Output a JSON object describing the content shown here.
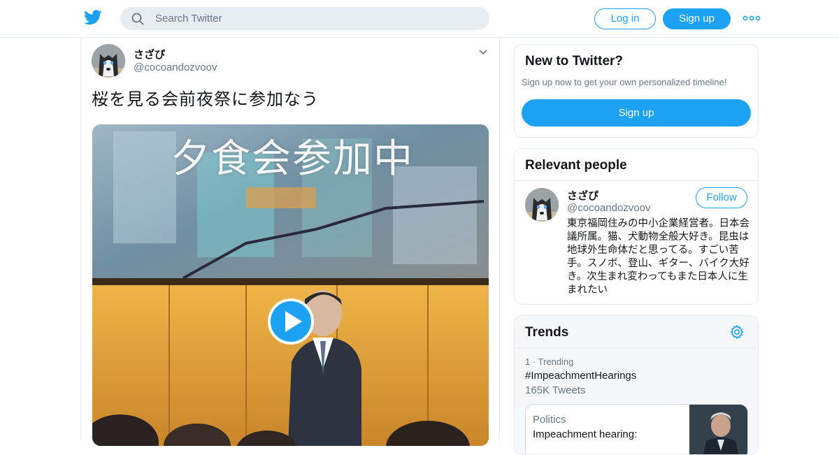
{
  "header": {
    "logo_icon": "twitter-bird-icon",
    "search_placeholder": "Search Twitter",
    "login_label": "Log in",
    "signup_label": "Sign up",
    "more_icon": "more-dots-icon",
    "brand_color": "#1da1f2"
  },
  "tweet": {
    "author_name": "さざぴ",
    "author_handle": "@cocoandozvoov",
    "text": "桜を見る会前夜祭に参加なう",
    "media": {
      "caption": "夕食会参加中",
      "play_icon": "play-icon"
    }
  },
  "sidebar": {
    "new_to_twitter": {
      "title": "New to Twitter?",
      "subtitle": "Sign up now to get your own personalized timeline!",
      "signup_label": "Sign up"
    },
    "relevant_people": {
      "title": "Relevant people",
      "person": {
        "name": "さざぴ",
        "handle": "@cocoandozvoov",
        "follow_label": "Follow",
        "bio": "東京福岡住みの中小企業経営者。日本会議所属。猫、犬動物全般大好き。昆虫は地球外生命体だと思ってる。すごい苦手。スノボ、登山、ギター、バイク大好き。次生まれ変わってもまた日本人に生まれたい"
      }
    },
    "trends": {
      "title": "Trends",
      "items": [
        {
          "meta": "1 · Trending",
          "tag": "#ImpeachmentHearings",
          "count": "165K Tweets",
          "news": {
            "category": "Politics",
            "headline": "Impeachment hearing:"
          }
        }
      ]
    }
  }
}
